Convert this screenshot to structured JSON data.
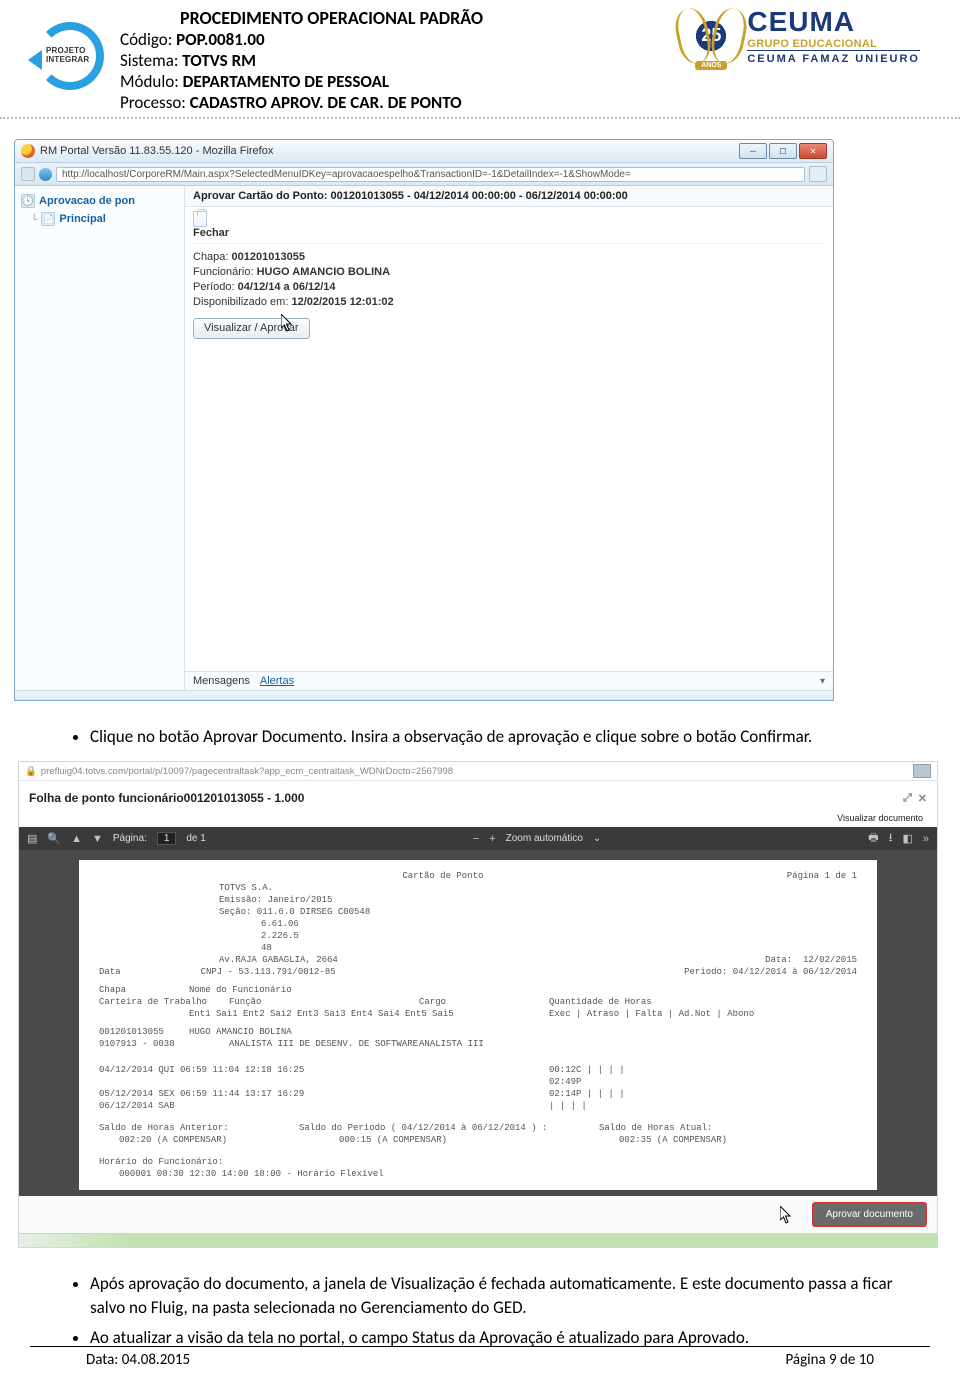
{
  "header": {
    "title": "PROCEDIMENTO OPERACIONAL PADRÃO",
    "codigo_label": "Código:",
    "codigo": "POP.0081.00",
    "sistema_label": "Sistema:",
    "sistema": "TOTVS RM",
    "modulo_label": "Módulo:",
    "modulo": "DEPARTAMENTO DE PESSOAL",
    "processo_label": "Processo:",
    "processo": "CADASTRO APROV. DE CAR. DE PONTO",
    "projeto_logo_line1": "PROJETO",
    "projeto_logo_line2": "INTEGRAR",
    "badge_number": "25",
    "badge_anos": "ANOS",
    "ceuma_big": "CEUMA",
    "ceuma_mid": "GRUPO EDUCACIONAL",
    "ceuma_sm": "CEUMA FAMAZ UNIEURO"
  },
  "screenshot1": {
    "window_title": "RM Portal Versão 11.83.55.120 - Mozilla Firefox",
    "url": "http://localhost/CorporeRM/Main.aspx?SelectedMenuIDKey=aprovacaoespelho&TransactionID=-1&DetailIndex=-1&ShowMode=",
    "left_nav": {
      "item1": "Aprovacao de pon",
      "item2": "Principal"
    },
    "panel_title": "Aprovar Cartão do Ponto: 001201013055 - 04/12/2014 00:00:00 - 06/12/2014 00:00:00",
    "fechar_label": "Fechar",
    "info": {
      "chapa_label": "Chapa:",
      "chapa": "001201013055",
      "func_label": "Funcionário:",
      "func": "HUGO AMANCIO BOLINA",
      "periodo_label": "Período:",
      "periodo": "04/12/14 a 06/12/14",
      "disp_label": "Disponibilizado em:",
      "disp": "12/02/2015 12:01:02"
    },
    "visualizar_btn": "Visualizar / Aprovar",
    "msg_tab1": "Mensagens",
    "msg_tab2": "Alertas"
  },
  "bullets": {
    "b1": "Clique no botão Aprovar Documento. Insira a observação de aprovação e clique sobre o botão Confirmar.",
    "b2": "Após aprovação do documento, a janela de Visualização é fechada automaticamente. E este documento passa a ficar salvo no Fluig, na pasta selecionada no Gerenciamento do GED.",
    "b3": "Ao atualizar a visão da tela no portal, o campo Status da Aprovação é atualizado para Aprovado."
  },
  "screenshot2": {
    "url": "prefluig04.totvs.com/portal/p/10097/pagecentraltask?app_ecm_centraltask_WDNrDocto=2567998",
    "title": "Folha de ponto funcionário001201013055 - 1.000",
    "vis_doc": "Visualizar documento",
    "toolbar": {
      "pagina_label": "Página:",
      "page_current": "1",
      "page_of": "de 1",
      "zoom_label": "Zoom automático",
      "minus": "−",
      "plus": "+"
    },
    "report": {
      "h_title": "Cartão de Ponto",
      "pagina": "Página 1 de 1",
      "empresa": "TOTVS S.A.",
      "emissao": "Emissão: Janeiro/2015",
      "secao": "Seção: 011.6.0 DIRSEG C00548",
      "linha_cc1": "6.61.06",
      "linha_cc2": "2.226.5",
      "linha_cc3": "48",
      "endereco": "Av.RAJA GABAGLIA, 2664",
      "data_label": "Data:",
      "data": "12/02/2015",
      "cnpj": "CNPJ - 53.113.791/0012-85",
      "periodo_label": "Periodo:",
      "periodo": "04/12/2014  à  06/12/2014",
      "col_data": "Data",
      "col_chapa": "Chapa",
      "col_nome": "Nome do Funcionário",
      "col_ct": "Carteira de Trabalho",
      "col_funcao": "Função",
      "col_cargo": "Cargo",
      "col_qh": "Quantidade de Horas",
      "col_times": "Ent1  Sai1   Ent2  Sai2  Ent3   Sai3  Ent4  Sai4  Ent5   Sai5",
      "col_flags": "Exec  | Atraso | Falta | Ad.Not | Abono",
      "chapa_val": "001201013055",
      "nome_val": "HUGO AMANCIO BOLINA",
      "ct_val": "9107913 - 0030",
      "funcao_val": "ANALISTA III DE DESENV. DE SOFTWARE",
      "cargo_val": "ANALISTA III",
      "r1": "04/12/2014 QUI  06:59 11:04 12:18 16:25",
      "r1v": "00:12C |        |       |       |",
      "r2": "05/12/2014 SEX  06:59 11:44 13:17 16:29",
      "r2v_a": "02:49P",
      "r2v_b": "02:14P |        |       |       |",
      "r3": "06/12/2014 SAB",
      "r3v": "|        |       |       |",
      "saldo_ant_label": "Saldo de Horas Anterior:",
      "saldo_per_label": "Saldo do Periodo ( 04/12/2014 à 06/12/2014 ) :",
      "saldo_atu_label": "Saldo de Horas Atual:",
      "saldo_ant": "002:20 (A COMPENSAR)",
      "saldo_per": "000:15 (A COMPENSAR)",
      "saldo_atu": "002:35 (A COMPENSAR)",
      "horario_label": "Horário do Funcionário:",
      "horario": "000001     08:30 12:30 14:00 18:00 - Horário Flexível"
    },
    "approve_btn": "Aprovar documento"
  },
  "footer": {
    "data_label": "Data:",
    "data": "04.08.2015",
    "page": "Página 9 de 10"
  }
}
